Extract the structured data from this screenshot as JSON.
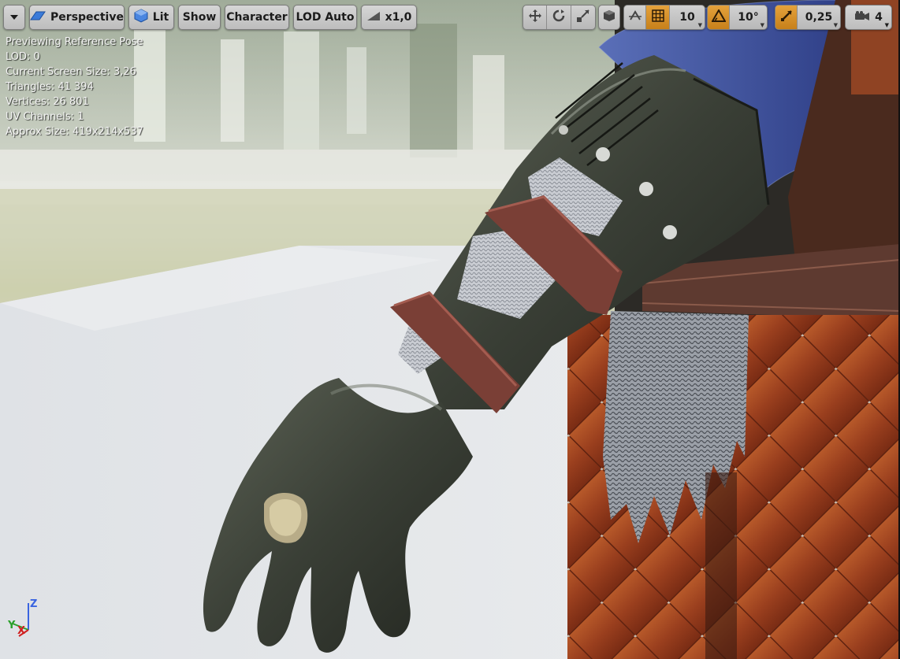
{
  "toolbar": {
    "view_options_icon": "chevron-down-icon",
    "perspective_label": "Perspective",
    "lit_label": "Lit",
    "show_label": "Show",
    "character_label": "Character",
    "lod_label": "LOD Auto",
    "play_speed_label": "x1,0",
    "transform_tools": [
      "move-icon",
      "rotate-icon",
      "scale-icon"
    ],
    "surface_snap_icon": "cube-icon",
    "world_local_icon": "globe-icon",
    "grid_snap_icon": "grid-icon",
    "grid_snap_value": "10",
    "rotation_snap_icon": "angle-icon",
    "rotation_snap_value": "10°",
    "scale_snap_icon": "scale-arrow-icon",
    "scale_snap_value": "0,25",
    "camera_speed_icon": "camera-icon",
    "camera_speed_value": "4",
    "accent_color": "#d08a22"
  },
  "stats": {
    "lines": [
      "Previewing Reference Pose",
      "LOD: 0",
      "Current Screen Size: 3,26",
      "Triangles: 41 394",
      "Vertices: 26 801",
      "UV Channels: 1",
      "Approx Size: 419x214x537"
    ]
  },
  "gizmo": {
    "z_label": "Z",
    "y_label": "Y",
    "x_label": "X"
  }
}
